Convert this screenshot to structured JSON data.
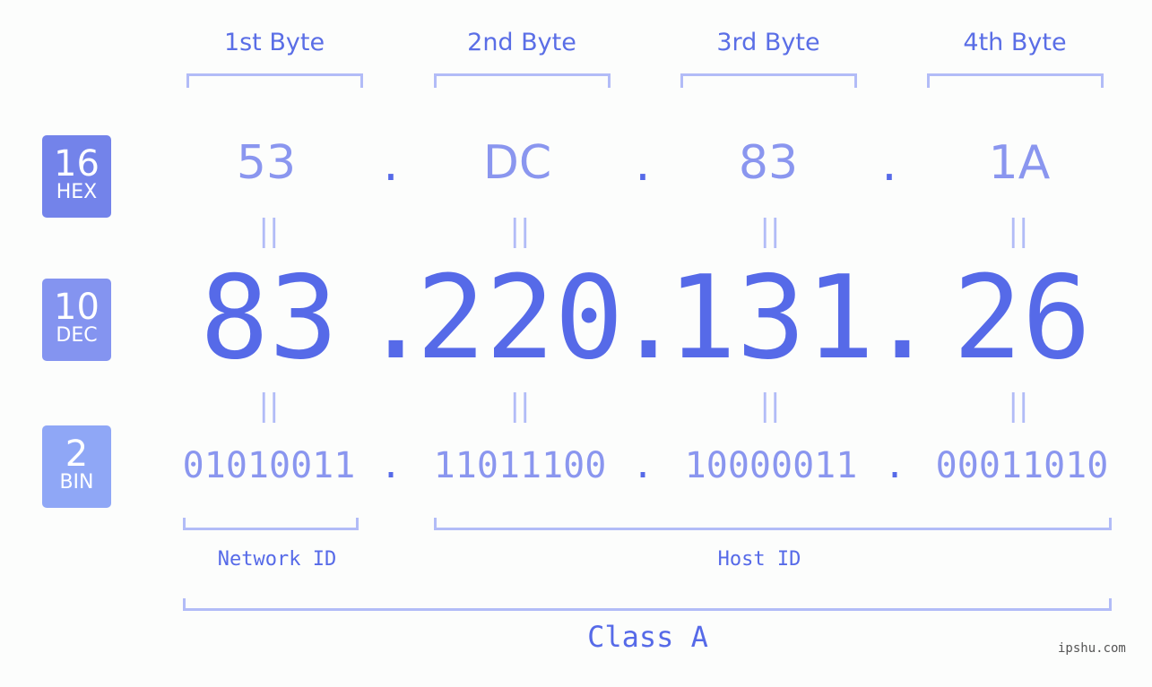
{
  "badges": [
    {
      "num": "16",
      "label": "HEX",
      "color": "#7383ea"
    },
    {
      "num": "10",
      "label": "DEC",
      "color": "#8494f0"
    },
    {
      "num": "2",
      "label": "BIN",
      "color": "#8fa7f6"
    }
  ],
  "byte_headers": [
    "1st Byte",
    "2nd Byte",
    "3rd Byte",
    "4th Byte"
  ],
  "hex": [
    "53",
    "DC",
    "83",
    "1A"
  ],
  "dec": [
    "83",
    "220",
    "131",
    "26"
  ],
  "bin": [
    "01010011",
    "11011100",
    "10000011",
    "00011010"
  ],
  "separator": ".",
  "equals": "||",
  "network_id_label": "Network ID",
  "host_id_label": "Host ID",
  "class_label": "Class A",
  "watermark": "ipshu.com",
  "colors": {
    "accent": "#566ae8",
    "light": "#8a96ef",
    "bracket": "#b2bcf7"
  }
}
